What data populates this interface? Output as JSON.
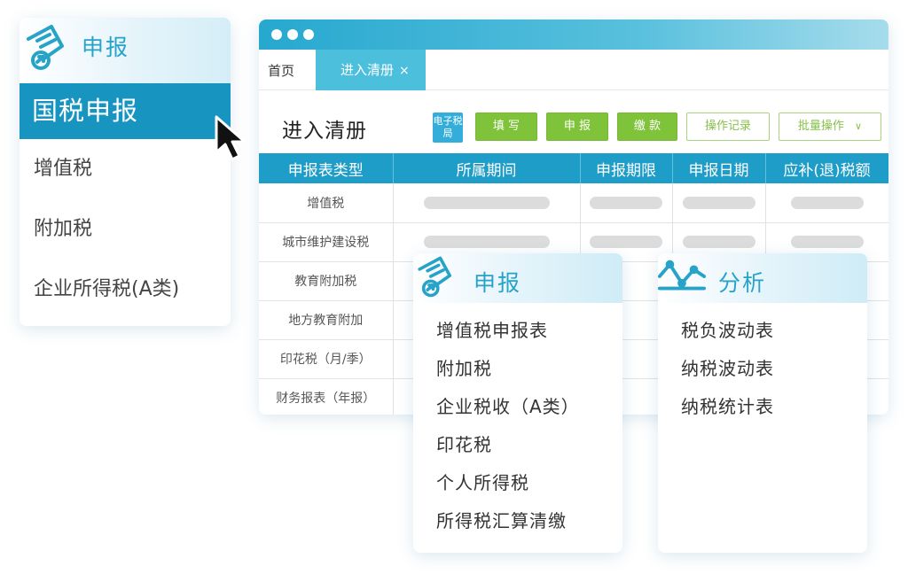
{
  "left_menu": {
    "title": "申报",
    "active_item": "国税申报",
    "items": [
      "增值税",
      "附加税",
      "企业所得税(A类)"
    ]
  },
  "window": {
    "tabs": {
      "home": "首页",
      "active": "进入清册",
      "close": "×"
    },
    "page_title": "进入清册",
    "etax_badge": "电子税局",
    "toolbar": {
      "fill": "填 写",
      "declare": "申 报",
      "pay": "缴 款",
      "history": "操作记录",
      "batch": "批量操作",
      "batch_arrow": "∨"
    },
    "table": {
      "columns": [
        "申报表类型",
        "所属期间",
        "申报期限",
        "申报日期",
        "应补(退)税额"
      ],
      "rows": [
        "增值税",
        "城市维护建设税",
        "教育附加税",
        "地方教育附加",
        "印花税（月/季）",
        "财务报表（年报）"
      ]
    }
  },
  "report_card": {
    "title": "申报",
    "items": [
      "增值税申报表",
      "附加税",
      "企业税收（A类）",
      "印花税",
      "个人所得税",
      "所得税汇算清缴"
    ]
  },
  "analysis_card": {
    "title": "分析",
    "items": [
      "税负波动表",
      "纳税波动表",
      "纳税统计表"
    ]
  },
  "colors": {
    "accent": "#1894c1",
    "header_blue": "#1f9dc9",
    "title_blue": "#27a3c8",
    "button_green": "#7fc33b"
  },
  "icons": [
    "document-icon",
    "chart-icon",
    "cursor-icon"
  ]
}
